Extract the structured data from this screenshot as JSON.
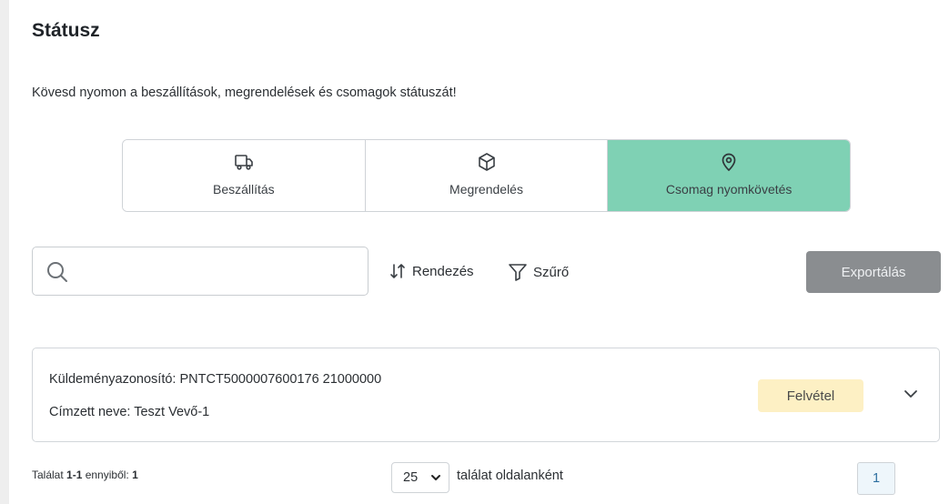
{
  "page": {
    "title": "Státusz",
    "subtitle": "Kövesd nyomon a beszállítások, megrendelések és csomagok státuszát!"
  },
  "tabs": [
    {
      "label": "Beszállítás",
      "icon": "truck-icon",
      "active": false
    },
    {
      "label": "Megrendelés",
      "icon": "box-icon",
      "active": false
    },
    {
      "label": "Csomag nyomkövetés",
      "icon": "location-pin-icon",
      "active": true
    }
  ],
  "toolbar": {
    "search_value": "",
    "search_placeholder": "",
    "sort_label": "Rendezés",
    "filter_label": "Szűrő",
    "export_label": "Exportálás"
  },
  "results": [
    {
      "tracking_line": "Küldeményazonosító: PNTCT5000007600176 21000000",
      "recipient_line": "Címzett neve: Teszt Vevő-1",
      "status": "Felvétel"
    }
  ],
  "footer": {
    "count_prefix": "Találat ",
    "count_range": "1-1",
    "count_middle": " ennyiből: ",
    "count_total": "1",
    "per_page_value": "25",
    "per_page_label": "találat oldalanként",
    "current_page": "1"
  },
  "colors": {
    "active_tab": "#7fd1b4",
    "export_button": "#8a8d90",
    "status_badge": "#fdf0c4",
    "page_button": "#eef6fb"
  }
}
